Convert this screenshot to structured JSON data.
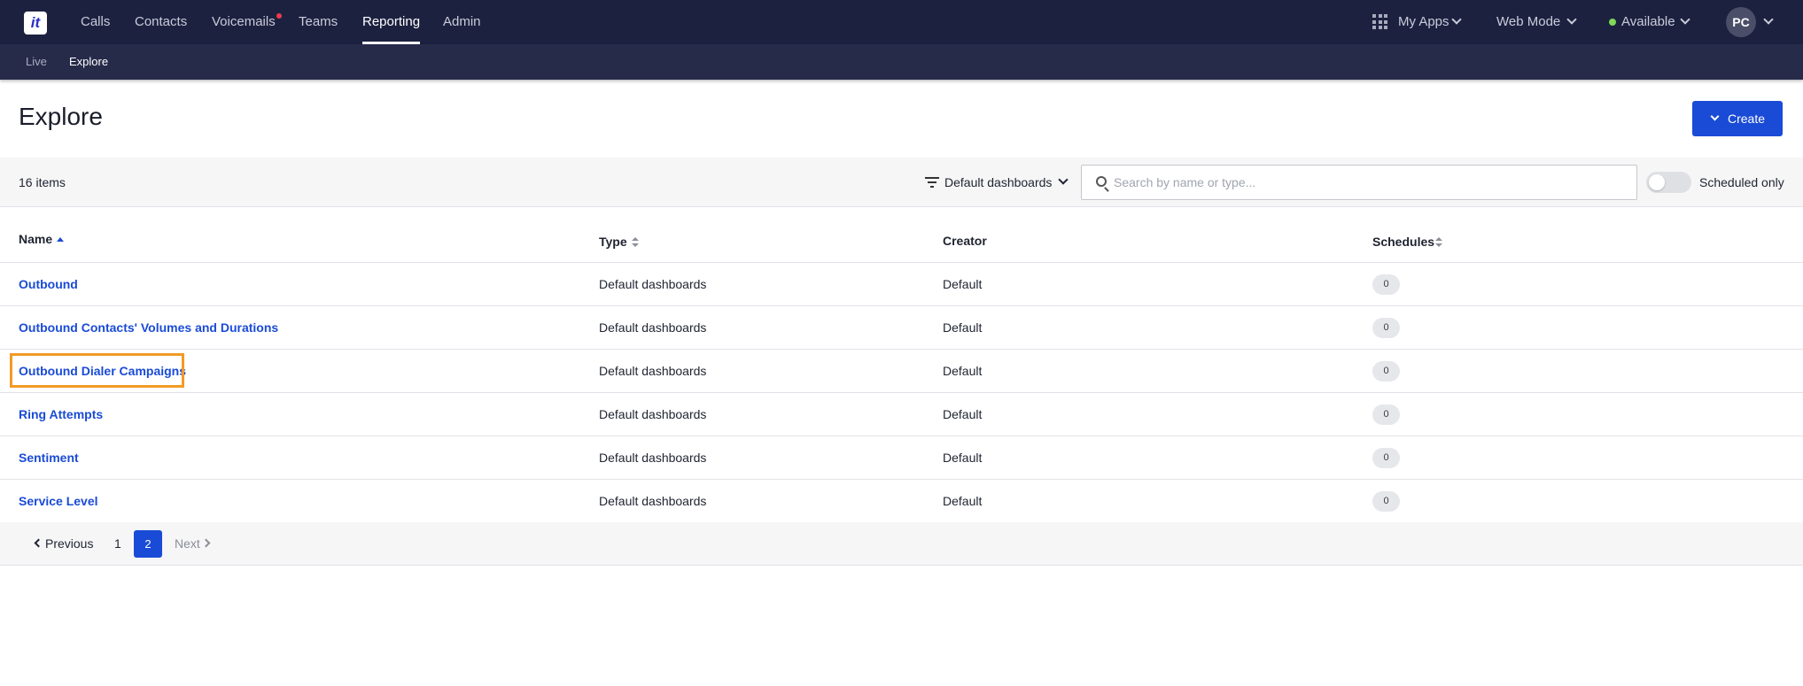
{
  "app": {
    "logo_text": "it"
  },
  "topnav": {
    "items": [
      {
        "label": "Calls"
      },
      {
        "label": "Contacts"
      },
      {
        "label": "Voicemails"
      },
      {
        "label": "Teams"
      },
      {
        "label": "Reporting"
      },
      {
        "label": "Admin"
      }
    ],
    "active": "Reporting",
    "my_apps": "My Apps",
    "web_mode": "Web Mode",
    "status": "Available",
    "avatar_initials": "PC"
  },
  "subnav": {
    "items": [
      {
        "label": "Live"
      },
      {
        "label": "Explore"
      }
    ],
    "active": "Explore"
  },
  "page": {
    "title": "Explore",
    "create_label": "Create"
  },
  "toolbar": {
    "items_count": "16 items",
    "filter_label": "Default dashboards",
    "search_placeholder": "Search by name or type...",
    "search_value": "",
    "scheduled_only_label": "Scheduled only",
    "scheduled_only_on": false
  },
  "table": {
    "columns": [
      "Name",
      "Type",
      "Creator",
      "Schedules"
    ],
    "sort": {
      "column": "Name",
      "direction": "ascending"
    },
    "rows": [
      {
        "name": "Outbound",
        "type": "Default dashboards",
        "creator": "Default",
        "schedules": "0"
      },
      {
        "name": "Outbound Contacts' Volumes and Durations",
        "type": "Default dashboards",
        "creator": "Default",
        "schedules": "0"
      },
      {
        "name": "Outbound Dialer Campaigns",
        "type": "Default dashboards",
        "creator": "Default",
        "schedules": "0"
      },
      {
        "name": "Ring Attempts",
        "type": "Default dashboards",
        "creator": "Default",
        "schedules": "0"
      },
      {
        "name": "Sentiment",
        "type": "Default dashboards",
        "creator": "Default",
        "schedules": "0"
      },
      {
        "name": "Service Level",
        "type": "Default dashboards",
        "creator": "Default",
        "schedules": "0"
      }
    ]
  },
  "pagination": {
    "previous": "Previous",
    "pages": [
      "1",
      "2"
    ],
    "current": "2",
    "next": "Next"
  },
  "colors": {
    "topbar": "#1d2140",
    "subbar": "#272b4a",
    "accent": "#1a4bd6",
    "highlight": "#f29b25",
    "notification_dot": "#ef3b4f",
    "available_dot": "#7ed957"
  }
}
